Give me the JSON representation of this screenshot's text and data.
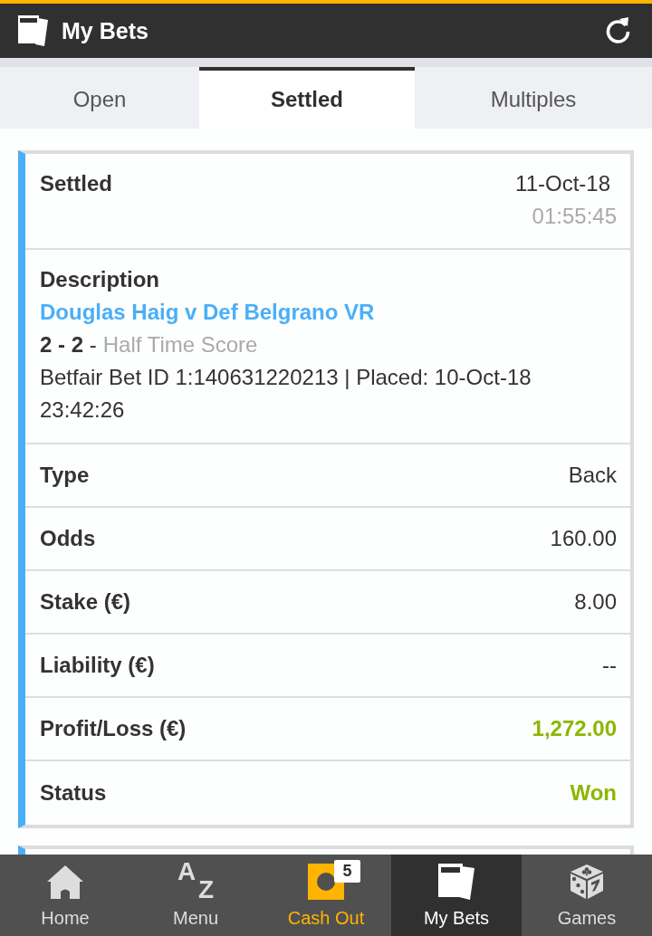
{
  "header": {
    "title": "My Bets"
  },
  "tabs": [
    {
      "label": "Open",
      "selected": false
    },
    {
      "label": "Settled",
      "selected": true
    },
    {
      "label": "Multiples",
      "selected": false
    }
  ],
  "bet": {
    "status_row": {
      "label": "Settled",
      "date": "11-Oct-18",
      "time": "01:55:45"
    },
    "description": {
      "label": "Description",
      "event": "Douglas Haig v Def Belgrano VR",
      "score": "**2 - 2** -",
      "market": "Half Time Score",
      "details": "Betfair Bet ID 1:140631220213 | Placed: 10-Oct-18 23:42:26"
    },
    "rows": [
      {
        "label": "Type",
        "value": "Back",
        "highlighted": false
      },
      {
        "label": "Odds",
        "value": "160.00",
        "highlighted": false
      },
      {
        "label": "Stake (€)",
        "value": "8.00",
        "highlighted": false
      },
      {
        "label": "Liability (€)",
        "value": "--",
        "highlighted": false
      },
      {
        "label": "Profit/Loss (€)",
        "value": "1,272.00",
        "highlighted": true
      },
      {
        "label": "Status",
        "value": "Won",
        "highlighted": true
      }
    ]
  },
  "nav": [
    {
      "kind": "home",
      "label": "Home",
      "selected": false,
      "accent": false
    },
    {
      "kind": "menu",
      "label": "Menu",
      "icon_letters": [
        "A",
        "Z"
      ],
      "selected": false,
      "accent": false
    },
    {
      "kind": "cashout",
      "label": "Cash Out",
      "badge": "5",
      "selected": false,
      "accent": true
    },
    {
      "kind": "mybets",
      "label": "My Bets",
      "selected": true,
      "accent": false
    },
    {
      "kind": "games",
      "label": "Games",
      "selected": false,
      "accent": false
    }
  ]
}
